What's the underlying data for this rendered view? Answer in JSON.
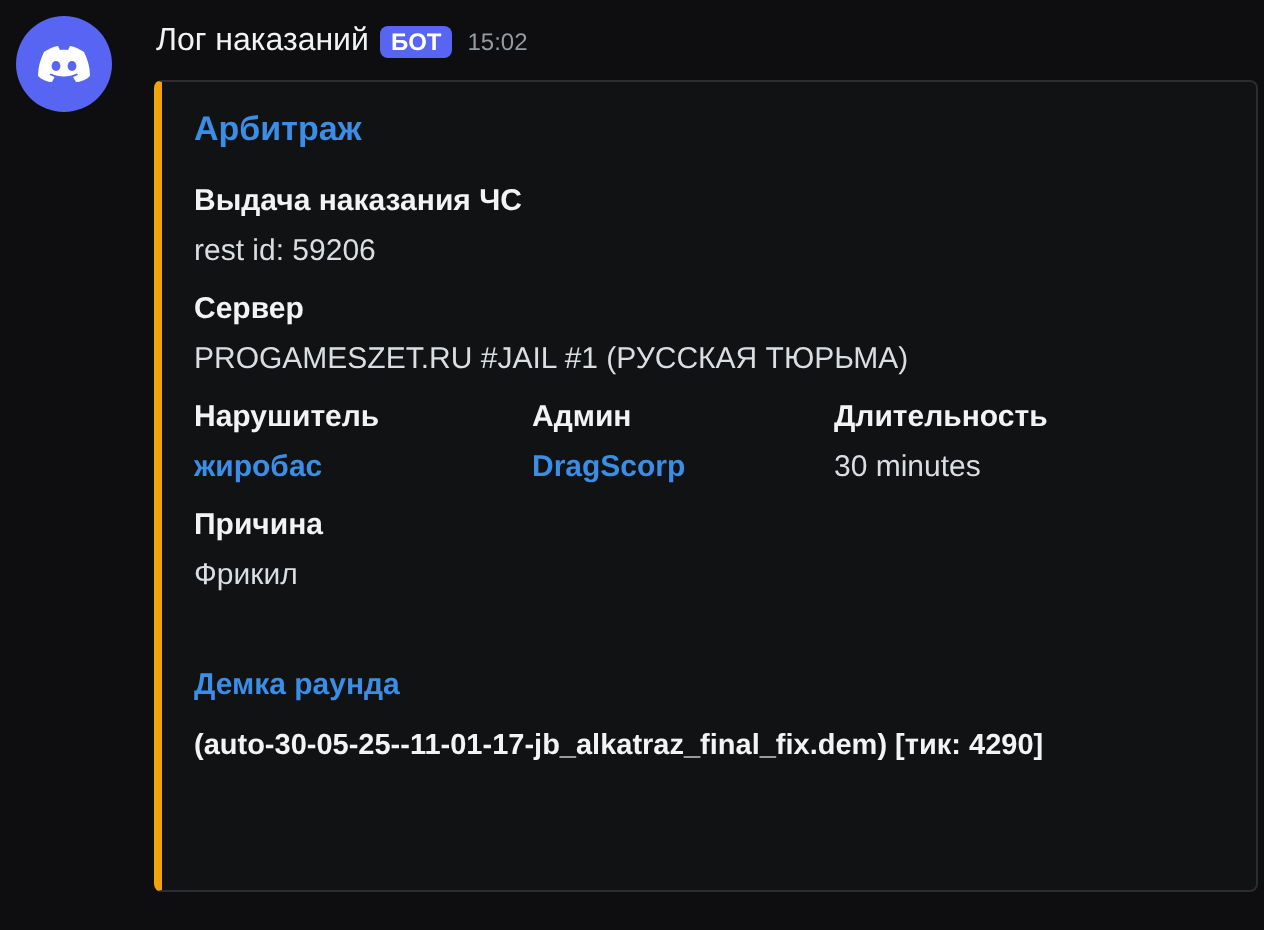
{
  "message": {
    "author": "Лог наказаний",
    "badge": "БОТ",
    "time": "15:02"
  },
  "embed": {
    "color": "#f0a30a",
    "title": "Арбитраж",
    "fields": [
      {
        "name": "Выдача наказания ЧС",
        "value": "rest id: 59206",
        "kind": "text",
        "inline": false
      },
      {
        "name": "Сервер",
        "value": "PROGAMESZET.RU #JAIL #1 (РУССКАЯ ТЮРЬМА)",
        "kind": "text",
        "inline": false
      },
      {
        "name": "Нарушитель",
        "value": "жиробас",
        "kind": "link",
        "inline": true
      },
      {
        "name": "Админ",
        "value": "DragScorp",
        "kind": "link",
        "inline": true
      },
      {
        "name": "Длительность",
        "value": "30 minutes",
        "kind": "text",
        "inline": true
      },
      {
        "name": "Причина",
        "value": "Фрикил",
        "kind": "text",
        "inline": false
      }
    ],
    "link_section": {
      "link": "Демка раунда",
      "text": "(auto-30-05-25--11-01-17-jb_alkatraz_final_fix.dem) [тик: 4290]"
    }
  }
}
